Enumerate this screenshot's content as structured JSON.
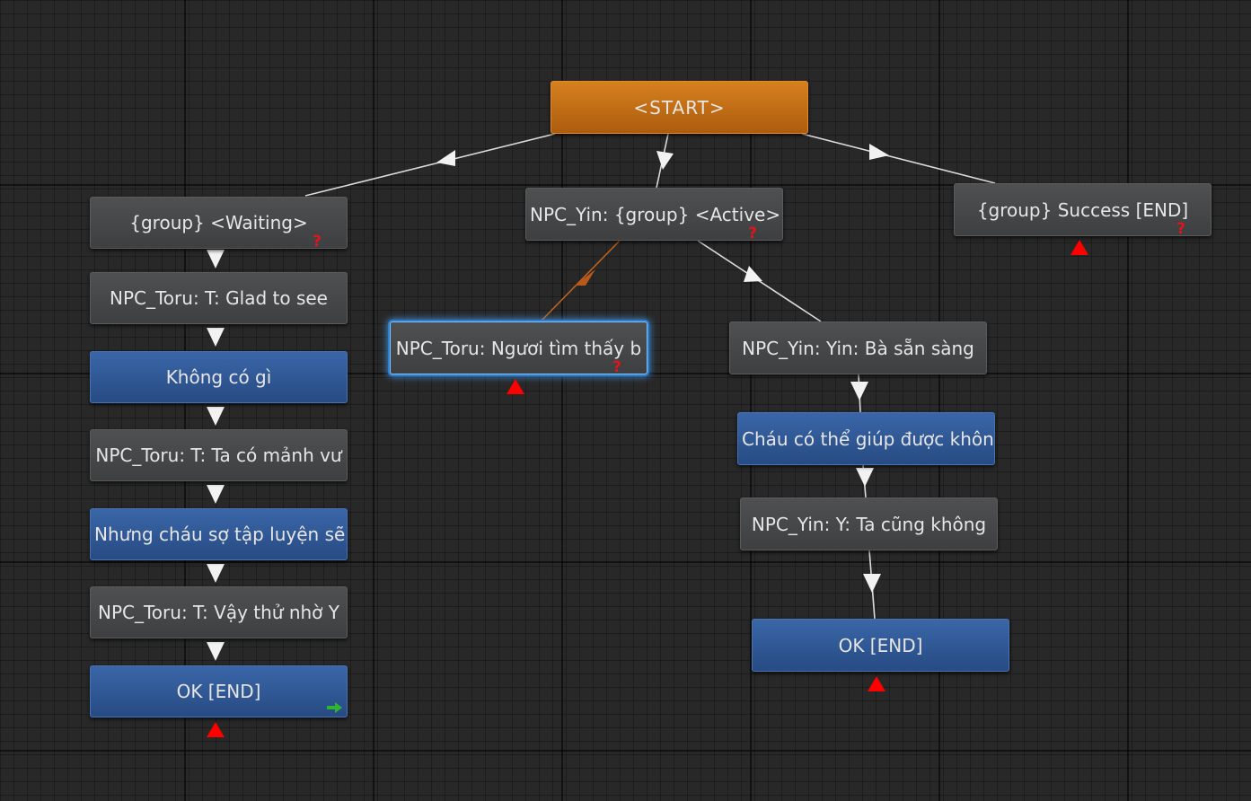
{
  "nodes": {
    "start": {
      "label": "<START>"
    },
    "waiting": {
      "label": "{group} <Waiting>"
    },
    "active": {
      "label": "NPC_Yin: {group} <Active>"
    },
    "success": {
      "label": "{group} Success [END]"
    },
    "toru_glad": {
      "label": "NPC_Toru:  T: Glad to see"
    },
    "khong_co_gi": {
      "label": "Không có gì"
    },
    "toru_ta_co": {
      "label": "NPC_Toru: T: Ta có mảnh vư"
    },
    "nhung_chau": {
      "label": "Nhưng cháu sợ tập luyện sẽ"
    },
    "toru_vay": {
      "label": "NPC_Toru: T: Vậy thử nhờ Y"
    },
    "ok_end_left": {
      "label": "OK  [END]"
    },
    "toru_nguoi": {
      "label": "NPC_Toru: Ngươi tìm thấy b"
    },
    "yin_ba": {
      "label": "NPC_Yin: Yin: Bà sẵn sàng"
    },
    "chau_co_the": {
      "label": "Cháu có thể giúp được khôn"
    },
    "yin_ta_cung": {
      "label": "NPC_Yin: Y: Ta cũng không"
    },
    "ok_end_right": {
      "label": "OK [END]"
    }
  },
  "markers": {
    "condition_symbol": "?",
    "colors": {
      "condition": "#e0141a",
      "end_marker": "#ff0000",
      "link": "#dcdcdc",
      "link_active": "#c0621e",
      "next_arrow": "#2fb52f",
      "start_node": "#c8711a",
      "response_node": "#2f5896",
      "dialogue_node": "#47484a"
    }
  }
}
